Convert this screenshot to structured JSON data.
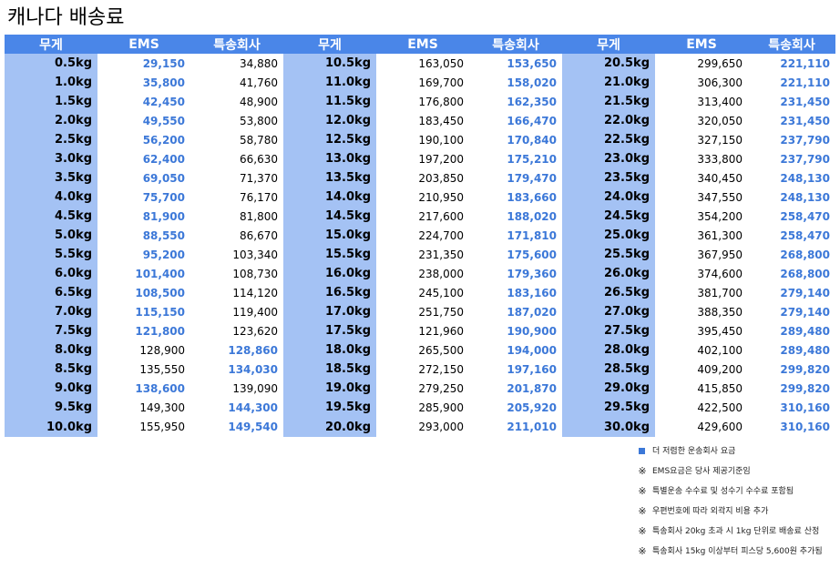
{
  "title": "캐나다 배송료",
  "headers": [
    "무게",
    "EMS",
    "특송회사",
    "무게",
    "EMS",
    "특송회사",
    "무게",
    "EMS",
    "특송회사"
  ],
  "colors": {
    "header_bg": "#4a86e8",
    "weight_bg": "#a4c2f4",
    "cheaper_text": "#3c78d8"
  },
  "rows": [
    [
      {
        "t": "0.5kg"
      },
      {
        "t": "29,150",
        "c": 1
      },
      {
        "t": "34,880"
      },
      {
        "t": "10.5kg"
      },
      {
        "t": "163,050"
      },
      {
        "t": "153,650",
        "c": 1
      },
      {
        "t": "20.5kg"
      },
      {
        "t": "299,650"
      },
      {
        "t": "221,110",
        "c": 1
      }
    ],
    [
      {
        "t": "1.0kg"
      },
      {
        "t": "35,800",
        "c": 1
      },
      {
        "t": "41,760"
      },
      {
        "t": "11.0kg"
      },
      {
        "t": "169,700"
      },
      {
        "t": "158,020",
        "c": 1
      },
      {
        "t": "21.0kg"
      },
      {
        "t": "306,300"
      },
      {
        "t": "221,110",
        "c": 1
      }
    ],
    [
      {
        "t": "1.5kg"
      },
      {
        "t": "42,450",
        "c": 1
      },
      {
        "t": "48,900"
      },
      {
        "t": "11.5kg"
      },
      {
        "t": "176,800"
      },
      {
        "t": "162,350",
        "c": 1
      },
      {
        "t": "21.5kg"
      },
      {
        "t": "313,400"
      },
      {
        "t": "231,450",
        "c": 1
      }
    ],
    [
      {
        "t": "2.0kg"
      },
      {
        "t": "49,550",
        "c": 1
      },
      {
        "t": "53,800"
      },
      {
        "t": "12.0kg"
      },
      {
        "t": "183,450"
      },
      {
        "t": "166,470",
        "c": 1
      },
      {
        "t": "22.0kg"
      },
      {
        "t": "320,050"
      },
      {
        "t": "231,450",
        "c": 1
      }
    ],
    [
      {
        "t": "2.5kg"
      },
      {
        "t": "56,200",
        "c": 1
      },
      {
        "t": "58,780"
      },
      {
        "t": "12.5kg"
      },
      {
        "t": "190,100"
      },
      {
        "t": "170,840",
        "c": 1
      },
      {
        "t": "22.5kg"
      },
      {
        "t": "327,150"
      },
      {
        "t": "237,790",
        "c": 1
      }
    ],
    [
      {
        "t": "3.0kg"
      },
      {
        "t": "62,400",
        "c": 1
      },
      {
        "t": "66,630"
      },
      {
        "t": "13.0kg"
      },
      {
        "t": "197,200"
      },
      {
        "t": "175,210",
        "c": 1
      },
      {
        "t": "23.0kg"
      },
      {
        "t": "333,800"
      },
      {
        "t": "237,790",
        "c": 1
      }
    ],
    [
      {
        "t": "3.5kg"
      },
      {
        "t": "69,050",
        "c": 1
      },
      {
        "t": "71,370"
      },
      {
        "t": "13.5kg"
      },
      {
        "t": "203,850"
      },
      {
        "t": "179,470",
        "c": 1
      },
      {
        "t": "23.5kg"
      },
      {
        "t": "340,450"
      },
      {
        "t": "248,130",
        "c": 1
      }
    ],
    [
      {
        "t": "4.0kg"
      },
      {
        "t": "75,700",
        "c": 1
      },
      {
        "t": "76,170"
      },
      {
        "t": "14.0kg"
      },
      {
        "t": "210,950"
      },
      {
        "t": "183,660",
        "c": 1
      },
      {
        "t": "24.0kg"
      },
      {
        "t": "347,550"
      },
      {
        "t": "248,130",
        "c": 1
      }
    ],
    [
      {
        "t": "4.5kg"
      },
      {
        "t": "81,900",
        "c": 1
      },
      {
        "t": "81,800"
      },
      {
        "t": "14.5kg"
      },
      {
        "t": "217,600"
      },
      {
        "t": "188,020",
        "c": 1
      },
      {
        "t": "24.5kg"
      },
      {
        "t": "354,200"
      },
      {
        "t": "258,470",
        "c": 1
      }
    ],
    [
      {
        "t": "5.0kg"
      },
      {
        "t": "88,550",
        "c": 1
      },
      {
        "t": "86,670"
      },
      {
        "t": "15.0kg"
      },
      {
        "t": "224,700"
      },
      {
        "t": "171,810",
        "c": 1
      },
      {
        "t": "25.0kg"
      },
      {
        "t": "361,300"
      },
      {
        "t": "258,470",
        "c": 1
      }
    ],
    [
      {
        "t": "5.5kg"
      },
      {
        "t": "95,200",
        "c": 1
      },
      {
        "t": "103,340"
      },
      {
        "t": "15.5kg"
      },
      {
        "t": "231,350"
      },
      {
        "t": "175,600",
        "c": 1
      },
      {
        "t": "25.5kg"
      },
      {
        "t": "367,950"
      },
      {
        "t": "268,800",
        "c": 1
      }
    ],
    [
      {
        "t": "6.0kg"
      },
      {
        "t": "101,400",
        "c": 1
      },
      {
        "t": "108,730"
      },
      {
        "t": "16.0kg"
      },
      {
        "t": "238,000"
      },
      {
        "t": "179,360",
        "c": 1
      },
      {
        "t": "26.0kg"
      },
      {
        "t": "374,600"
      },
      {
        "t": "268,800",
        "c": 1
      }
    ],
    [
      {
        "t": "6.5kg"
      },
      {
        "t": "108,500",
        "c": 1
      },
      {
        "t": "114,120"
      },
      {
        "t": "16.5kg"
      },
      {
        "t": "245,100"
      },
      {
        "t": "183,160",
        "c": 1
      },
      {
        "t": "26.5kg"
      },
      {
        "t": "381,700"
      },
      {
        "t": "279,140",
        "c": 1
      }
    ],
    [
      {
        "t": "7.0kg"
      },
      {
        "t": "115,150",
        "c": 1
      },
      {
        "t": "119,400"
      },
      {
        "t": "17.0kg"
      },
      {
        "t": "251,750"
      },
      {
        "t": "187,020",
        "c": 1
      },
      {
        "t": "27.0kg"
      },
      {
        "t": "388,350"
      },
      {
        "t": "279,140",
        "c": 1
      }
    ],
    [
      {
        "t": "7.5kg"
      },
      {
        "t": "121,800",
        "c": 1
      },
      {
        "t": "123,620"
      },
      {
        "t": "17.5kg"
      },
      {
        "t": "121,960"
      },
      {
        "t": "190,900",
        "c": 1
      },
      {
        "t": "27.5kg"
      },
      {
        "t": "395,450"
      },
      {
        "t": "289,480",
        "c": 1
      }
    ],
    [
      {
        "t": "8.0kg"
      },
      {
        "t": "128,900"
      },
      {
        "t": "128,860",
        "c": 1
      },
      {
        "t": "18.0kg"
      },
      {
        "t": "265,500"
      },
      {
        "t": "194,000",
        "c": 1
      },
      {
        "t": "28.0kg"
      },
      {
        "t": "402,100"
      },
      {
        "t": "289,480",
        "c": 1
      }
    ],
    [
      {
        "t": "8.5kg"
      },
      {
        "t": "135,550"
      },
      {
        "t": "134,030",
        "c": 1
      },
      {
        "t": "18.5kg"
      },
      {
        "t": "272,150"
      },
      {
        "t": "197,160",
        "c": 1
      },
      {
        "t": "28.5kg"
      },
      {
        "t": "409,200"
      },
      {
        "t": "299,820",
        "c": 1
      }
    ],
    [
      {
        "t": "9.0kg"
      },
      {
        "t": "138,600",
        "c": 1
      },
      {
        "t": "139,090"
      },
      {
        "t": "19.0kg"
      },
      {
        "t": "279,250"
      },
      {
        "t": "201,870",
        "c": 1
      },
      {
        "t": "29.0kg"
      },
      {
        "t": "415,850"
      },
      {
        "t": "299,820",
        "c": 1
      }
    ],
    [
      {
        "t": "9.5kg"
      },
      {
        "t": "149,300"
      },
      {
        "t": "144,300",
        "c": 1
      },
      {
        "t": "19.5kg"
      },
      {
        "t": "285,900"
      },
      {
        "t": "205,920",
        "c": 1
      },
      {
        "t": "29.5kg"
      },
      {
        "t": "422,500"
      },
      {
        "t": "310,160",
        "c": 1
      }
    ],
    [
      {
        "t": "10.0kg"
      },
      {
        "t": "155,950"
      },
      {
        "t": "149,540",
        "c": 1
      },
      {
        "t": "20.0kg"
      },
      {
        "t": "293,000"
      },
      {
        "t": "211,010",
        "c": 1
      },
      {
        "t": "30.0kg"
      },
      {
        "t": "429,600"
      },
      {
        "t": "310,160",
        "c": 1
      }
    ]
  ],
  "notes": [
    {
      "mark": "square",
      "text": "더 저렴한 운송회사 요금"
    },
    {
      "mark": "※",
      "text": "EMS요금은 당사 제공기준임"
    },
    {
      "mark": "※",
      "text": "특별운송 수수료 및 성수기 수수료 포함됨"
    },
    {
      "mark": "※",
      "text": "우편번호에 따라 외곽지 비용 추가"
    },
    {
      "mark": "※",
      "text": "특송회사 20kg 초과 시 1kg 단위로 배송료 산정"
    },
    {
      "mark": "※",
      "text": "특송회사 15kg 이상부터 피스당 5,600원 추가됨"
    }
  ]
}
